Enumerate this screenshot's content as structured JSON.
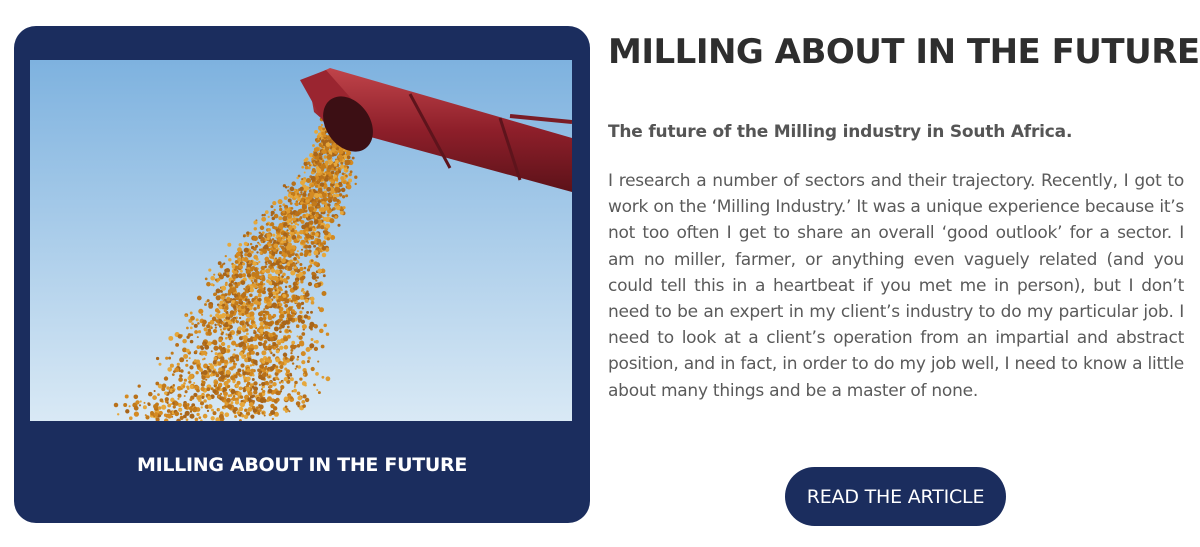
{
  "colors": {
    "card_background": "#1b2d5e",
    "button_background": "#1b2d5e",
    "title_text": "#2e2e2e",
    "body_text": "#5a5a5a"
  },
  "card": {
    "image_alt": "Grain pouring from a red auger spout against a blue sky",
    "caption": "MILLING ABOUT IN THE FUTURE"
  },
  "article": {
    "title": "MILLING ABOUT IN THE FUTURE",
    "subtitle": "The future of the Milling industry in South Africa.",
    "body": "I research a number of sectors and their trajectory. Recently, I got to work on the ‘Milling Industry.’ It was a unique experience because it’s not too often I get to share an overall ‘good outlook’ for a sector. I am no miller, farmer, or anything even vaguely related (and you could tell this in a heartbeat if you met me in person), but I don’t need to be an expert in my client’s industry to do my particular job. I need to look at a client’s operation from an impartial and abstract position, and in fact, in order to do my job well, I need to know a little about many things and be a master of none.",
    "cta_label": "READ THE ARTICLE"
  }
}
